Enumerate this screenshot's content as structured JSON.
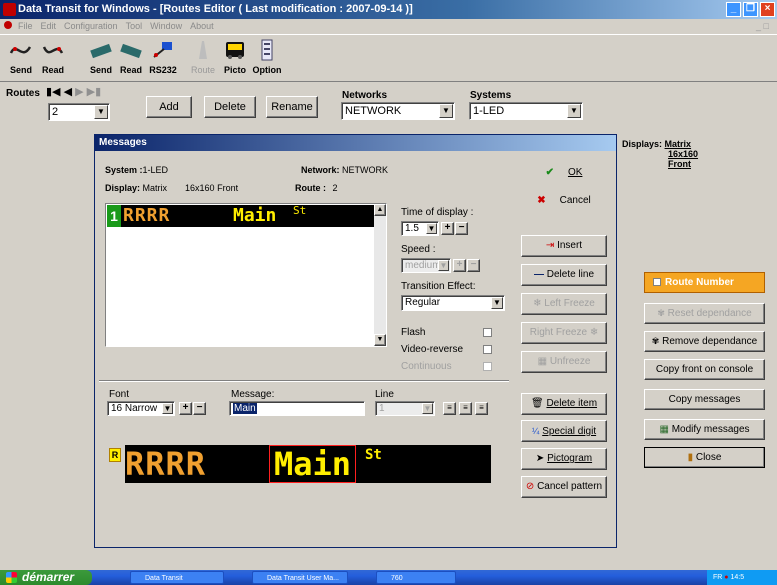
{
  "window": {
    "title": "Data Transit for Windows - [Routes Editor ( Last modification : 2007-09-14 )]"
  },
  "menu": {
    "items": [
      "File",
      "Edit",
      "Configuration",
      "Tool",
      "Window",
      "About"
    ]
  },
  "toolbar": {
    "send1": "Send",
    "read1": "Read",
    "send2": "Send",
    "read2": "Read",
    "rs232": "RS232",
    "route": "Route",
    "picto": "Picto",
    "option": "Option"
  },
  "routes": {
    "label": "Routes",
    "value": "2",
    "add": "Add",
    "delete": "Delete",
    "rename": "Rename"
  },
  "networks": {
    "label": "Networks",
    "value": "NETWORK"
  },
  "systems": {
    "label": "Systems",
    "value": "1-LED"
  },
  "displays_info": {
    "label": "Displays:",
    "type": "Matrix",
    "size": "16x160",
    "side": "Front"
  },
  "dialog": {
    "title": "Messages",
    "system_label": "System :",
    "system_value": "1-LED",
    "network_label": "Network:",
    "network_value": "NETWORK",
    "display_label": "Display:",
    "display_type": "Matrix",
    "display_size": "16x160",
    "display_side": "Front",
    "route_label": "Route :",
    "route_value": "2",
    "led_line_no": "1",
    "led_route": "RRRR",
    "led_main": "Main",
    "led_sup": "St",
    "time_label": "Time of display :",
    "time_value": "1.5",
    "speed_label": "Speed :",
    "speed_value": "medium",
    "transition_label": "Transition Effect:",
    "transition_value": "Regular",
    "flash_label": "Flash",
    "video_label": "Video-reverse",
    "continuous_label": "Continuous",
    "font_label": "Font",
    "font_value": "16 Narrow",
    "message_label": "Message:",
    "message_value": "Main",
    "line_label": "Line",
    "line_value": "1",
    "preview_badge": "R",
    "ok": "OK",
    "cancel": "Cancel",
    "insert": "Insert",
    "delete_line": "Delete line",
    "left_freeze": "Left Freeze",
    "right_freeze": "Right Freeze",
    "unfreeze": "Unfreeze",
    "delete_item": "Delete item",
    "special_digit": "Special digit",
    "pictogram": "Pictogram",
    "cancel_pattern": "Cancel pattern"
  },
  "right_panel": {
    "route_number": "Route Number",
    "reset_dependance": "Reset dependance",
    "remove_dependance": "Remove dependance",
    "copy_front": "Copy front on console",
    "copy_messages": "Copy messages",
    "modify_messages": "Modify messages",
    "close": "Close"
  },
  "taskbar": {
    "start": "démarrer",
    "tasks": [
      "Data Transit",
      "Data Transit User Ma...",
      "760"
    ],
    "clock": "14:5",
    "lang": "FR"
  },
  "colors": {
    "led_route": "#f0a030",
    "led_text": "#ffee00",
    "led_badge": "#1a9a1a",
    "accent_orange": "#f5a623"
  }
}
